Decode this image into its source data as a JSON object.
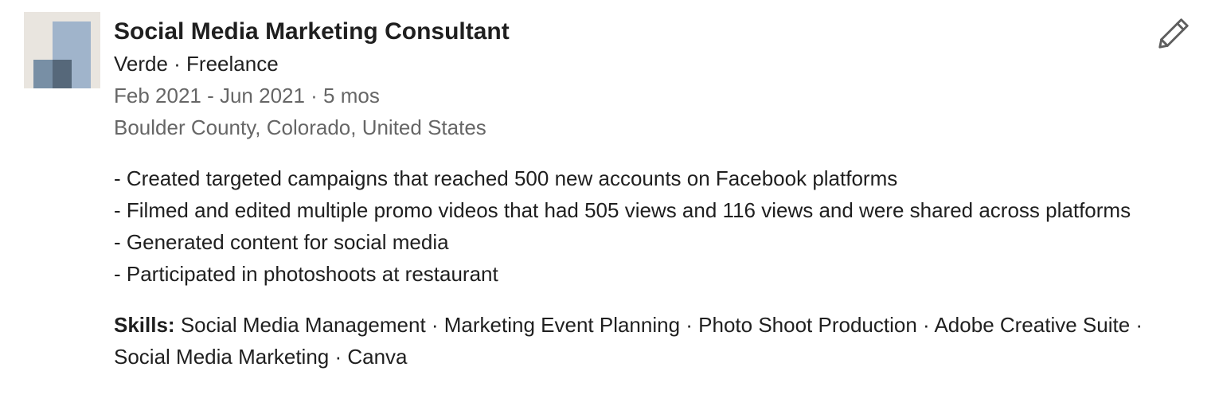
{
  "experience": {
    "title": "Social Media Marketing Consultant",
    "company_line": "Verde · Freelance",
    "date_range": "Feb 2021 - Jun 2021 · 5 mos",
    "location": "Boulder County, Colorado, United States",
    "description_lines": [
      "- Created targeted campaigns that reached 500 new accounts on Facebook platforms",
      "- Filmed and edited multiple promo videos that had 505 views and 116 views and were shared across platforms",
      "- Generated content for social media",
      "- Participated in photoshoots at restaurant"
    ],
    "skills_label": "Skills:",
    "skills_text": "Social Media Management · Marketing Event Planning · Photo Shoot Production · Adobe Creative Suite · Social Media Marketing · Canva"
  },
  "icons": {
    "edit": "pencil-icon",
    "company_logo": "company-logo"
  }
}
